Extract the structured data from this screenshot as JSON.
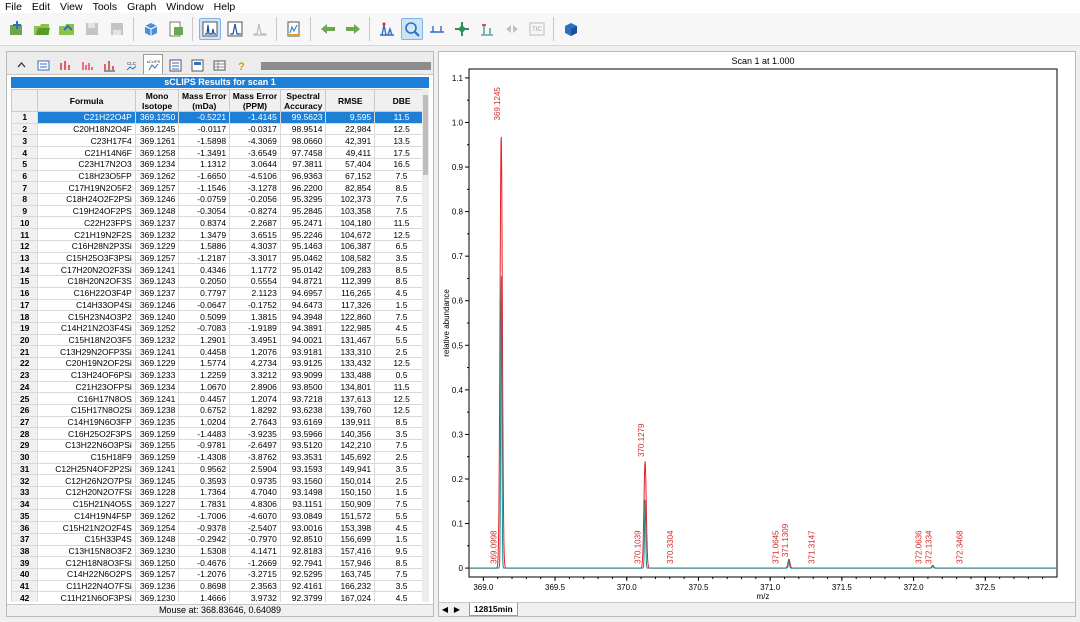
{
  "menu": [
    "File",
    "Edit",
    "View",
    "Tools",
    "Graph",
    "Window",
    "Help"
  ],
  "toolbar_icons": [
    "new-method-icon",
    "open-folder-icon",
    "open-data-icon",
    "save-disabled-icon",
    "print-disabled-icon",
    "cube-icon",
    "export-icon",
    "spectrum-view-icon",
    "peak-view-icon",
    "chromatogram-icon",
    "calibration-icon",
    "back-arrow-icon",
    "forward-arrow-icon",
    "peak-pick-icon",
    "zoom-icon",
    "baseline-icon",
    "crosshair-icon",
    "marker-icon",
    "tic-icon",
    "3d-cube-icon"
  ],
  "left_tabs": [
    "up-arrow-icon",
    "list-icon",
    "peak-label-icon",
    "isotope-icon",
    "mass-icon",
    "clc-icon",
    "sclips-icon",
    "settings-icon",
    "report-icon",
    "table-icon",
    "help-icon"
  ],
  "results_title": "sCLIPS Results for scan 1",
  "table": {
    "headers": [
      {
        "id": "idx",
        "label": ""
      },
      {
        "id": "formula",
        "label": "Formula"
      },
      {
        "id": "mono",
        "label": "Mono Isotope"
      },
      {
        "id": "err_mda",
        "label": "Mass Error (mDa)"
      },
      {
        "id": "err_ppm",
        "label": "Mass Error (PPM)"
      },
      {
        "id": "acc",
        "label": "Spectral Accuracy"
      },
      {
        "id": "rmse",
        "label": "RMSE"
      },
      {
        "id": "dbe",
        "label": "DBE"
      }
    ],
    "selected_row": 1,
    "rows": [
      [
        "1",
        "C21H22O4P",
        "369.1250",
        "-0.5221",
        "-1.4145",
        "99.5623",
        "9,595",
        "11.5"
      ],
      [
        "2",
        "C20H18N2O4F",
        "369.1245",
        "-0.0117",
        "-0.0317",
        "98.9514",
        "22,984",
        "12.5"
      ],
      [
        "3",
        "C23H17F4",
        "369.1261",
        "-1.5898",
        "-4.3069",
        "98.0660",
        "42,391",
        "13.5"
      ],
      [
        "4",
        "C21H14N6F",
        "369.1258",
        "-1.3491",
        "-3.6549",
        "97.7458",
        "49,411",
        "17.5"
      ],
      [
        "5",
        "C23H17N2O3",
        "369.1234",
        "1.1312",
        "3.0644",
        "97.3811",
        "57,404",
        "16.5"
      ],
      [
        "6",
        "C18H23O5FP",
        "369.1262",
        "-1.6650",
        "-4.5106",
        "96.9363",
        "67,152",
        "7.5"
      ],
      [
        "7",
        "C17H19N2O5F2",
        "369.1257",
        "-1.1546",
        "-3.1278",
        "96.2200",
        "82,854",
        "8.5"
      ],
      [
        "8",
        "C18H24O2F2PSi",
        "369.1246",
        "-0.0759",
        "-0.2056",
        "95.3295",
        "102,373",
        "7.5"
      ],
      [
        "9",
        "C19H24OF2PS",
        "369.1248",
        "-0.3054",
        "-0.8274",
        "95.2845",
        "103,358",
        "7.5"
      ],
      [
        "10",
        "C22H23FPS",
        "369.1237",
        "0.8374",
        "2.2687",
        "95.2471",
        "104,180",
        "11.5"
      ],
      [
        "11",
        "C21H19N2F2S",
        "369.1232",
        "1.3479",
        "3.6515",
        "95.2246",
        "104,672",
        "12.5"
      ],
      [
        "12",
        "C16H28N2P3Si",
        "369.1229",
        "1.5886",
        "4.3037",
        "95.1463",
        "106,387",
        "6.5"
      ],
      [
        "13",
        "C15H25O3F3PSi",
        "369.1257",
        "-1.2187",
        "-3.3017",
        "95.0462",
        "108,582",
        "3.5"
      ],
      [
        "14",
        "C17H20N2O2F3Si",
        "369.1241",
        "0.4346",
        "1.1772",
        "95.0142",
        "109,283",
        "8.5"
      ],
      [
        "15",
        "C18H20N2OF3S",
        "369.1243",
        "0.2050",
        "0.5554",
        "94.8721",
        "112,399",
        "8.5"
      ],
      [
        "16",
        "C16H22O3F4P",
        "369.1237",
        "0.7797",
        "2.1123",
        "94.6957",
        "116,265",
        "4.5"
      ],
      [
        "17",
        "C14H33OP4Si",
        "369.1246",
        "-0.0647",
        "-0.1752",
        "94.6473",
        "117,326",
        "1.5"
      ],
      [
        "18",
        "C15H23N4O3P2",
        "369.1240",
        "0.5099",
        "1.3815",
        "94.3948",
        "122,860",
        "7.5"
      ],
      [
        "19",
        "C14H21N2O3F4Si",
        "369.1252",
        "-0.7083",
        "-1.9189",
        "94.3891",
        "122,985",
        "4.5"
      ],
      [
        "20",
        "C15H18N2O3F5",
        "369.1232",
        "1.2901",
        "3.4951",
        "94.0021",
        "131,467",
        "5.5"
      ],
      [
        "21",
        "C13H29N2OFP3Si",
        "369.1241",
        "0.4458",
        "1.2076",
        "93.9181",
        "133,310",
        "2.5"
      ],
      [
        "22",
        "C20H19N2OF2Si",
        "369.1229",
        "1.5774",
        "4.2734",
        "93.9125",
        "133,432",
        "12.5"
      ],
      [
        "23",
        "C13H24OF6PSi",
        "369.1233",
        "1.2259",
        "3.3212",
        "93.9099",
        "133,488",
        "0.5"
      ],
      [
        "24",
        "C21H23OFPSi",
        "369.1234",
        "1.0670",
        "2.8906",
        "93.8500",
        "134,801",
        "11.5"
      ],
      [
        "25",
        "C16H17N8OS",
        "369.1241",
        "0.4457",
        "1.2074",
        "93.7218",
        "137,613",
        "12.5"
      ],
      [
        "26",
        "C15H17N8O2Si",
        "369.1238",
        "0.6752",
        "1.8292",
        "93.6238",
        "139,760",
        "12.5"
      ],
      [
        "27",
        "C14H19N6O3FP",
        "369.1235",
        "1.0204",
        "2.7643",
        "93.6169",
        "139,911",
        "8.5"
      ],
      [
        "28",
        "C16H25O2F3PS",
        "369.1259",
        "-1.4483",
        "-3.9235",
        "93.5966",
        "140,356",
        "3.5"
      ],
      [
        "29",
        "C13H22N6O3PSi",
        "369.1255",
        "-0.9781",
        "-2.6497",
        "93.5120",
        "142,210",
        "7.5"
      ],
      [
        "30",
        "C15H18F9",
        "369.1259",
        "-1.4308",
        "-3.8762",
        "93.3531",
        "145,692",
        "2.5"
      ],
      [
        "31",
        "C12H25N4OF2P2Si",
        "369.1241",
        "0.9562",
        "2.5904",
        "93.1593",
        "149,941",
        "3.5"
      ],
      [
        "32",
        "C12H26N2O7PSi",
        "369.1245",
        "0.3593",
        "0.9735",
        "93.1560",
        "150,014",
        "2.5"
      ],
      [
        "33",
        "C12H20N2O7FSi",
        "369.1228",
        "1.7364",
        "4.7040",
        "93.1498",
        "150,150",
        "1.5"
      ],
      [
        "34",
        "C15H21N4O5S",
        "369.1227",
        "1.7831",
        "4.8306",
        "93.1151",
        "150,909",
        "7.5"
      ],
      [
        "35",
        "C14H19N4F5P",
        "369.1262",
        "-1.7006",
        "-4.6070",
        "93.0849",
        "151,572",
        "5.5"
      ],
      [
        "36",
        "C15H21N2O2F4S",
        "369.1254",
        "-0.9378",
        "-2.5407",
        "93.0016",
        "153,398",
        "4.5"
      ],
      [
        "37",
        "C15H33P4S",
        "369.1248",
        "-0.2942",
        "-0.7970",
        "92.8510",
        "156,699",
        "1.5"
      ],
      [
        "38",
        "C13H15N8O3F2",
        "369.1230",
        "1.5308",
        "4.1471",
        "92.8183",
        "157,416",
        "9.5"
      ],
      [
        "39",
        "C12H18N8O3FSi",
        "369.1250",
        "-0.4676",
        "-1.2669",
        "92.7941",
        "157,946",
        "8.5"
      ],
      [
        "40",
        "C14H22N6O2PS",
        "369.1257",
        "-1.2076",
        "-3.2715",
        "92.5295",
        "163,745",
        "7.5"
      ],
      [
        "41",
        "C11H22N4O7FSi",
        "369.1236",
        "0.8698",
        "2.3563",
        "92.4161",
        "166,232",
        "3.5"
      ],
      [
        "42",
        "C11H21N6OF3PSi",
        "369.1230",
        "1.4666",
        "3.9732",
        "92.3799",
        "167,024",
        "4.5"
      ],
      [
        "43",
        "C13H15N6F6",
        "369.1257",
        "-1.1901",
        "-3.2242",
        "92.3298",
        "168,122",
        "6.5"
      ],
      [
        "44",
        "C14H29N2FP3S",
        "369.1243",
        "0.2162",
        "0.5858",
        "92.2248",
        "170,423",
        "2.5"
      ]
    ]
  },
  "status": {
    "text": "Mouse at: 368.83646, 0.64089"
  },
  "bottom_tab": "12815min",
  "chart_data": {
    "type": "line",
    "title": "Scan 1 at 1.000",
    "xlabel": "m/z",
    "ylabel": "relative abundance",
    "xlim": [
      368.9,
      373.0
    ],
    "ylim": [
      -0.02,
      1.12
    ],
    "xticks": [
      "369.0",
      "369.5",
      "370.0",
      "370.5",
      "371.0",
      "371.5",
      "372.0",
      "372.5"
    ],
    "yticks": [
      "0",
      "0.1",
      "0.2",
      "0.3",
      "0.4",
      "0.5",
      "0.6",
      "0.7",
      "0.8",
      "0.9",
      "1.0",
      "1.1"
    ],
    "grid": false,
    "series": [
      {
        "color": "#e8202a",
        "peaks": [
          [
            369.1245,
            0.975,
            0.008
          ],
          [
            370.1279,
            0.24,
            0.008
          ],
          [
            371.1309,
            0.02,
            0.007
          ],
          [
            372.1334,
            0.006,
            0.007
          ]
        ]
      },
      {
        "color": "#1a8a8a",
        "peaks": [
          [
            369.125,
            0.66,
            0.004
          ],
          [
            370.128,
            0.155,
            0.004
          ],
          [
            371.1305,
            0.016,
            0.004
          ],
          [
            372.134,
            0.005,
            0.004
          ]
        ]
      }
    ],
    "annotations": [
      {
        "x": 369.1245,
        "y": 1.0,
        "label": "369.1245"
      },
      {
        "x": 369.0998,
        "y": 0.005,
        "label": "369.0998"
      },
      {
        "x": 370.1279,
        "y": 0.245,
        "label": "370.1279"
      },
      {
        "x": 370.1039,
        "y": 0.005,
        "label": "370.1039"
      },
      {
        "x": 370.3304,
        "y": 0.005,
        "label": "370.3304"
      },
      {
        "x": 371.0645,
        "y": 0.005,
        "label": "371.0645"
      },
      {
        "x": 371.1309,
        "y": 0.02,
        "label": "371.1309"
      },
      {
        "x": 371.3147,
        "y": 0.005,
        "label": "371.3147"
      },
      {
        "x": 372.0636,
        "y": 0.005,
        "label": "372.0636"
      },
      {
        "x": 372.1334,
        "y": 0.005,
        "label": "372.1334"
      },
      {
        "x": 372.3468,
        "y": 0.005,
        "label": "372.3468"
      }
    ]
  }
}
